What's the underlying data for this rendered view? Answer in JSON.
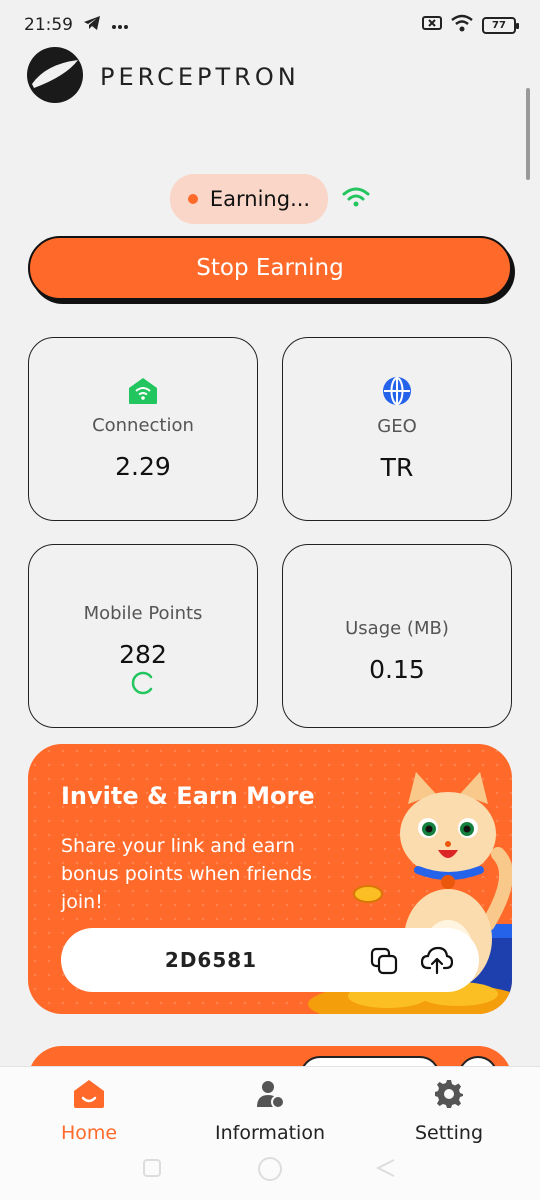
{
  "status_bar": {
    "time": "21:59",
    "notification_icons": [
      "telegram-icon",
      "more-dots-icon"
    ],
    "system_icons": [
      "sim-off-icon",
      "wifi-icon",
      "battery-icon"
    ],
    "battery_level": "77"
  },
  "header": {
    "brand": "PERCEPTRON"
  },
  "status": {
    "earning_label": "Earning...",
    "signal_icon": "wifi-signal-icon",
    "signal_color": "#22c55e"
  },
  "actions": {
    "stop_label": "Stop Earning"
  },
  "stats": [
    {
      "label": "Connection",
      "value": "2.29",
      "icon": "home-wifi-icon",
      "icon_color": "#22c55e"
    },
    {
      "label": "GEO",
      "value": "TR",
      "icon": "globe-icon",
      "icon_color": "#2563eb"
    },
    {
      "label": "Mobile Points",
      "value": "282",
      "icon": "loading-spinner-icon",
      "icon_color": "#22c55e"
    },
    {
      "label": "Usage (MB)",
      "value": "0.15"
    }
  ],
  "invite": {
    "title": "Invite & Earn More",
    "description": "Share your link and earn bonus points when friends join!",
    "code": "2D6581",
    "copy_icon": "copy-icon",
    "share_icon": "upload-cloud-icon"
  },
  "bottom_nav": {
    "items": [
      {
        "label": "Home",
        "icon": "home-icon",
        "active": true
      },
      {
        "label": "Information",
        "icon": "user-group-icon",
        "active": false
      },
      {
        "label": "Setting",
        "icon": "gear-icon",
        "active": false
      }
    ]
  },
  "colors": {
    "accent": "#ff6a2b",
    "background": "#f1f1f1",
    "pill": "#f9d6c8"
  }
}
